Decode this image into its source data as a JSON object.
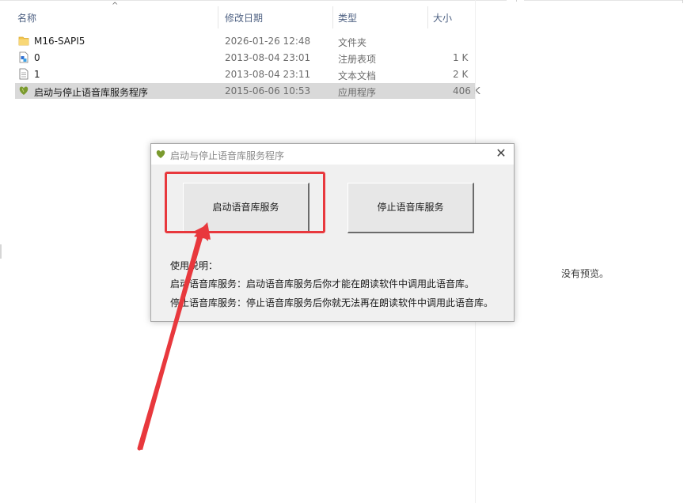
{
  "columns": {
    "name": "名称",
    "date": "修改日期",
    "type": "类型",
    "size": "大小"
  },
  "files": [
    {
      "name": "M16-SAPI5",
      "date": "2026-01-26 12:48",
      "type": "文件夹",
      "size": "",
      "icon": "folder-icon"
    },
    {
      "name": "0",
      "date": "2013-08-04 23:01",
      "type": "注册表项",
      "size": "1 K",
      "icon": "registry-file-icon"
    },
    {
      "name": "1",
      "date": "2013-08-04 23:11",
      "type": "文本文档",
      "size": "2 K",
      "icon": "text-file-icon"
    },
    {
      "name": "启动与停止语音库服务程序",
      "date": "2015-06-06 10:53",
      "type": "应用程序",
      "size": "406 K",
      "icon": "app-icon",
      "selected": true
    }
  ],
  "preview": {
    "empty_text": "没有预览。"
  },
  "dialog": {
    "title": "启动与停止语音库服务程序",
    "close_symbol": "✕",
    "start_button": "启动语音库服务",
    "stop_button": "停止语音库服务",
    "instructions_title": "使用说明：",
    "instruction_1": "启动语音库服务：启动语音库服务后你才能在朗读软件中调用此语音库。",
    "instruction_2": "停止语音库服务：停止语音库服务后你就无法再在朗读软件中调用此语音库。"
  },
  "colors": {
    "annotation": "#e8383d",
    "selection": "#d9d9d9",
    "header_text": "#4d6082",
    "folder": "#f3c54c",
    "app_icon": "#7a9a2e"
  }
}
